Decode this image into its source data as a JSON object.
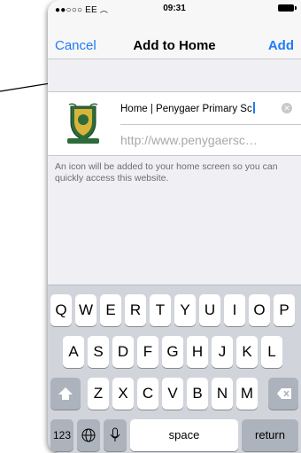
{
  "status_bar": {
    "carrier": "●●○○○ EE",
    "time": "09:31"
  },
  "nav": {
    "cancel_label": "Cancel",
    "title": "Add to Home",
    "add_label": "Add"
  },
  "form": {
    "title_value": "Home | Penygaer Primary Sc",
    "clear_icon": "clear-circle-icon",
    "url_placeholder": "http://www.penygaersc…"
  },
  "hint_text": "An icon will be added to your home screen so you can quickly access this website.",
  "keyboard": {
    "row1": [
      "Q",
      "W",
      "E",
      "R",
      "T",
      "Y",
      "U",
      "I",
      "O",
      "P"
    ],
    "row2": [
      "A",
      "S",
      "D",
      "F",
      "G",
      "H",
      "J",
      "K",
      "L"
    ],
    "row3": [
      "Z",
      "X",
      "C",
      "V",
      "B",
      "N",
      "M"
    ],
    "numbers_label": "123",
    "space_label": "space",
    "return_label": "return",
    "icons": [
      "shift-icon",
      "backspace-icon",
      "globe-icon",
      "microphone-icon"
    ]
  },
  "colors": {
    "accent": "#1f7cf7",
    "background": "#efeff4",
    "keyboard": "#d1d5db"
  }
}
